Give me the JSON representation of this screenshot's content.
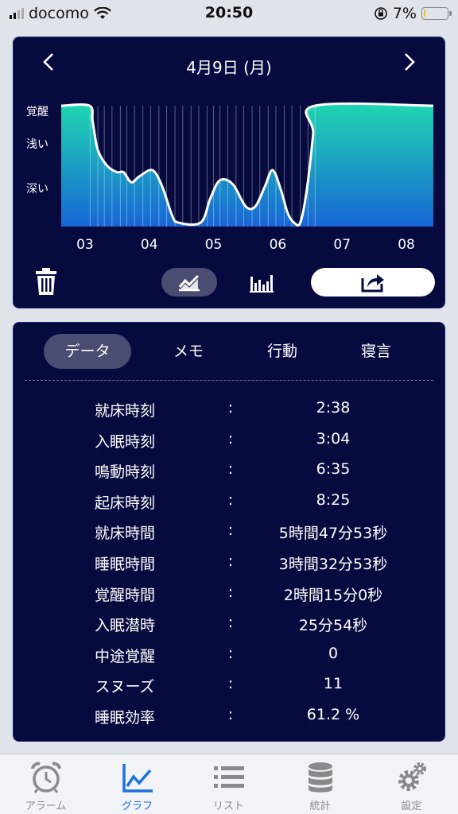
{
  "status_bar": {
    "carrier": "docomo",
    "time": "20:50",
    "battery_text": "7%",
    "battery_level": 0.07
  },
  "chart": {
    "title": "4月9日 (月)",
    "prev_icon": "chevron-left-icon",
    "next_icon": "chevron-right-icon"
  },
  "chart_data": {
    "type": "area",
    "ylabels": [
      "覚醒",
      "浅い",
      "深い"
    ],
    "x_ticks": [
      "03",
      "04",
      "05",
      "06",
      "07",
      "08"
    ],
    "x_range": [
      2.63,
      8.42
    ],
    "y_range": [
      0,
      3
    ],
    "points": [
      [
        2.63,
        3
      ],
      [
        3.07,
        3
      ],
      [
        3.12,
        2.6
      ],
      [
        3.2,
        1.9
      ],
      [
        3.35,
        1.5
      ],
      [
        3.5,
        1.35
      ],
      [
        3.6,
        1.35
      ],
      [
        3.72,
        1.1
      ],
      [
        3.85,
        1.25
      ],
      [
        4.05,
        1.4
      ],
      [
        4.2,
        1.0
      ],
      [
        4.35,
        0.3
      ],
      [
        4.45,
        0.1
      ],
      [
        4.8,
        0.1
      ],
      [
        4.95,
        0.7
      ],
      [
        5.1,
        1.15
      ],
      [
        5.3,
        1.05
      ],
      [
        5.5,
        0.5
      ],
      [
        5.65,
        0.5
      ],
      [
        5.8,
        1.0
      ],
      [
        5.92,
        1.4
      ],
      [
        6.05,
        0.9
      ],
      [
        6.15,
        0.35
      ],
      [
        6.25,
        0.1
      ],
      [
        6.35,
        0.1
      ],
      [
        6.45,
        0.9
      ],
      [
        6.55,
        2.3
      ],
      [
        6.58,
        3
      ],
      [
        8.42,
        3
      ]
    ],
    "grid": true
  },
  "actions": {
    "delete_icon": "trash-icon",
    "line_chart_icon": "line-chart-icon",
    "bar_chart_icon": "bar-chart-icon",
    "share_icon": "share-icon"
  },
  "tabs": [
    "データ",
    "メモ",
    "行動",
    "寝言"
  ],
  "stats": [
    {
      "label": "就床時刻",
      "value": "2:38"
    },
    {
      "label": "入眠時刻",
      "value": "3:04"
    },
    {
      "label": "鳴動時刻",
      "value": "6:35"
    },
    {
      "label": "起床時刻",
      "value": "8:25"
    },
    {
      "label": "就床時間",
      "value": "5時間47分53秒"
    },
    {
      "label": "睡眠時間",
      "value": "3時間32分53秒"
    },
    {
      "label": "覚醒時間",
      "value": "2時間15分0秒"
    },
    {
      "label": "入眠潜時",
      "value": "25分54秒"
    },
    {
      "label": "中途覚醒",
      "value": "0"
    },
    {
      "label": "スヌーズ",
      "value": "11"
    },
    {
      "label": "睡眠効率",
      "value": "61.2 %"
    }
  ],
  "colon": ":",
  "tabbar": [
    {
      "label": "アラーム",
      "icon": "alarm-clock-icon"
    },
    {
      "label": "グラフ",
      "icon": "graph-icon"
    },
    {
      "label": "リスト",
      "icon": "list-icon"
    },
    {
      "label": "統計",
      "icon": "database-icon"
    },
    {
      "label": "設定",
      "icon": "gear-icon"
    }
  ]
}
